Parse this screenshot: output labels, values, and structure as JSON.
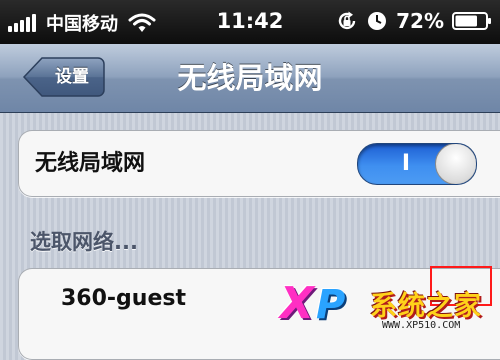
{
  "status_bar": {
    "carrier": "中国移动",
    "time": "11:42",
    "battery_percent": "72%",
    "signal_bars": 5,
    "icons": [
      "signal-icon",
      "wifi-icon",
      "rotation-lock-icon",
      "alarm-icon",
      "battery-icon"
    ]
  },
  "nav_bar": {
    "back_label": "设置",
    "title": "无线局域网"
  },
  "wifi_toggle": {
    "label": "无线局域网",
    "on_text": "I",
    "state": "on",
    "accent_color": "#3a88ee"
  },
  "networks": {
    "section_header": "选取网络...",
    "items": [
      {
        "name": "360-guest"
      }
    ]
  },
  "watermark": {
    "x_letter": "X",
    "p_letter": "P",
    "brand": "系统之家",
    "url": "WWW.XP510.COM"
  },
  "colors": {
    "status_bar_bg": "#111111",
    "nav_bar_bg": "#8ea2bd",
    "page_bg": "#c5ccd8",
    "toggle_on": "#3a88ee",
    "highlight_box": "#ff1a1a"
  }
}
